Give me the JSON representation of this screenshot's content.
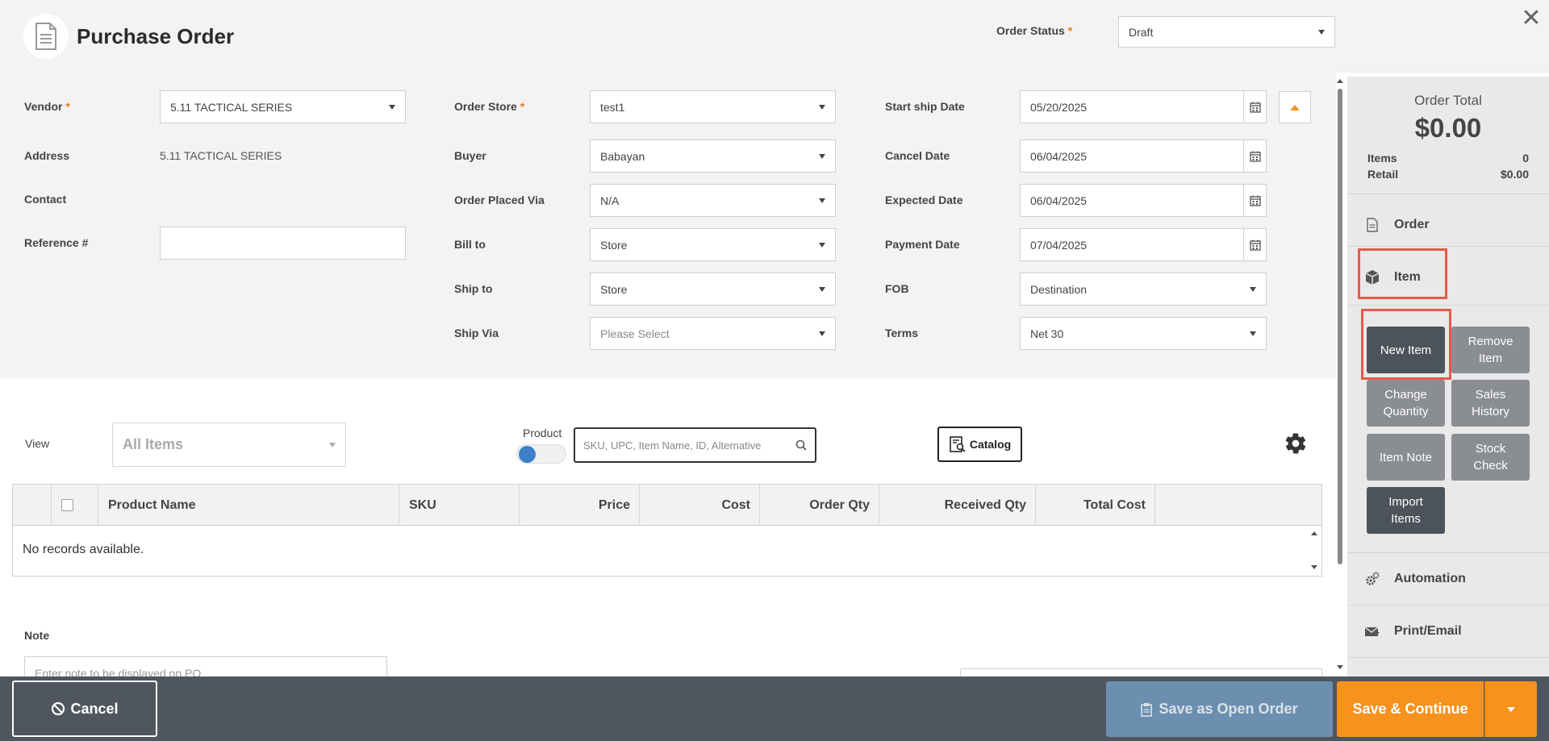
{
  "header": {
    "title": "Purchase Order",
    "order_status_label": "Order Status",
    "order_status_value": "Draft"
  },
  "form": {
    "vendor_label": "Vendor",
    "vendor_value": "5.11 TACTICAL SERIES",
    "address_label": "Address",
    "address_value": "5.11 TACTICAL SERIES",
    "contact_label": "Contact",
    "reference_label": "Reference #",
    "order_store_label": "Order Store",
    "order_store_value": "test1",
    "buyer_label": "Buyer",
    "buyer_value": "Babayan",
    "order_placed_via_label": "Order Placed Via",
    "order_placed_via_value": "N/A",
    "bill_to_label": "Bill to",
    "bill_to_value": "Store",
    "ship_to_label": "Ship to",
    "ship_to_value": "Store",
    "ship_via_label": "Ship Via",
    "ship_via_value": "Please Select",
    "start_ship_label": "Start ship Date",
    "start_ship_value": "05/20/2025",
    "cancel_date_label": "Cancel Date",
    "cancel_date_value": "06/04/2025",
    "expected_date_label": "Expected Date",
    "expected_date_value": "06/04/2025",
    "payment_date_label": "Payment Date",
    "payment_date_value": "07/04/2025",
    "fob_label": "FOB",
    "fob_value": "Destination",
    "terms_label": "Terms",
    "terms_value": "Net 30"
  },
  "toolbar": {
    "view_label": "View",
    "view_value": "All Items",
    "product_label": "Product",
    "search_placeholder": "SKU, UPC, Item Name, ID, Alternative",
    "catalog_label": "Catalog"
  },
  "grid": {
    "columns": [
      "Product Name",
      "SKU",
      "Price",
      "Cost",
      "Order Qty",
      "Received Qty",
      "Total Cost"
    ],
    "empty_text": "No records available."
  },
  "note": {
    "label": "Note",
    "placeholder": "Enter note to be displayed on PO"
  },
  "panel": {
    "order_total_label": "Order Total",
    "order_total_value": "$0.00",
    "items_label": "Items",
    "items_value": "0",
    "retail_label": "Retail",
    "retail_value": "$0.00",
    "nav_order": "Order",
    "nav_item": "Item",
    "nav_automation": "Automation",
    "nav_print_email": "Print/Email",
    "btn_new_item": "New Item",
    "btn_remove_item": "Remove Item",
    "btn_change_quantity": "Change Quantity",
    "btn_sales_history": "Sales History",
    "btn_item_note": "Item Note",
    "btn_stock_check": "Stock Check",
    "btn_import_items": "Import Items"
  },
  "footer": {
    "cancel_label": "Cancel",
    "save_open_label": "Save as Open Order",
    "save_continue_label": "Save & Continue"
  },
  "colors": {
    "accent_orange": "#f7921e",
    "highlight_red": "#e55a4a",
    "toggle_blue": "#3d7fc9",
    "bottom_bar": "#4f565d"
  }
}
